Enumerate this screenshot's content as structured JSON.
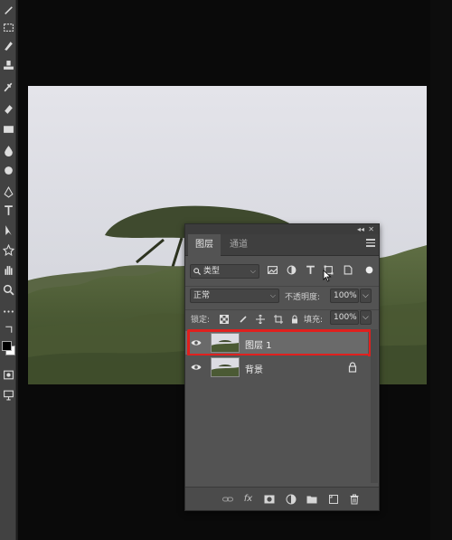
{
  "toolbar": {
    "tools": [
      "brush-icon",
      "marquee-icon",
      "pen-tool-icon",
      "stamp-icon",
      "history-brush-icon",
      "eraser-icon",
      "gradient-icon",
      "blur-icon",
      "dodge-icon",
      "pen-icon",
      "path-select-icon",
      "move-icon",
      "shape-icon",
      "hand-icon",
      "zoom-icon",
      "more-icon",
      "swap-colors-icon"
    ]
  },
  "panel": {
    "collapse_label": "◂◂",
    "close_label": "✕",
    "tabs": [
      {
        "label": "图层"
      },
      {
        "label": "通道"
      }
    ],
    "filter": {
      "kind_value": "类型",
      "icons": [
        "image-filter-icon",
        "adjustment-filter-icon",
        "type-filter-icon",
        "shape-filter-icon",
        "smart-object-filter-icon",
        "toggle-filter-icon"
      ]
    },
    "blend": {
      "mode_value": "正常",
      "opacity_label": "不透明度:",
      "opacity_value": "100%"
    },
    "lock": {
      "label": "锁定:",
      "fill_label": "填充:",
      "fill_value": "100%"
    },
    "layers": [
      {
        "name": "图层 1",
        "selected": true
      },
      {
        "name": "背景",
        "selected": false,
        "locked": true
      }
    ],
    "bottom_icons": [
      "link-layers-icon",
      "fx-icon",
      "layer-mask-icon",
      "adjustment-layer-icon",
      "group-folder-icon",
      "new-layer-icon",
      "delete-layer-icon"
    ],
    "fx_label": "fx"
  },
  "colors": {
    "selection_outline": "#e0201e",
    "panel_bg": "#535353",
    "selected_layer": "#6a6a6a"
  }
}
